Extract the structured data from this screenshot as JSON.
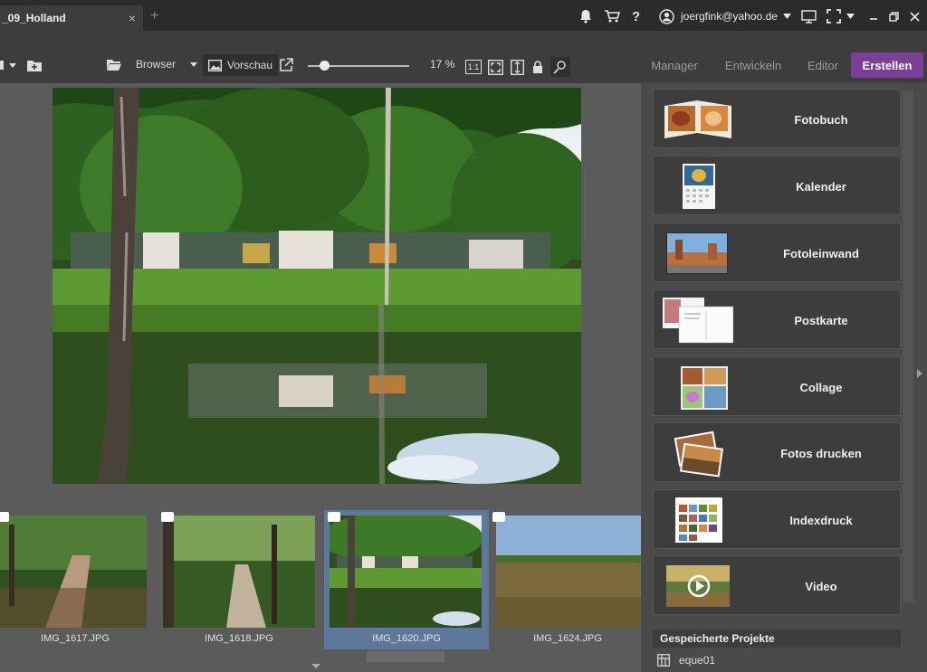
{
  "titlebar": {
    "tab_title": "_09_Holland",
    "tab_close": "×",
    "add_tab": "+",
    "user_email": "joergfink@yahoo.de"
  },
  "toolbar": {
    "browser_label": "Browser",
    "preview_label": "Vorschau",
    "zoom_level": "17 %",
    "zoom_fraction": 0.17,
    "ratio_label": "1:1"
  },
  "modes": [
    {
      "label": "Manager",
      "active": false
    },
    {
      "label": "Entwickeln",
      "active": false
    },
    {
      "label": "Editor",
      "active": false
    },
    {
      "label": "Erstellen",
      "active": true
    }
  ],
  "filmstrip": [
    {
      "name": "IMG_1617.JPG",
      "selected": false
    },
    {
      "name": "IMG_1618.JPG",
      "selected": false
    },
    {
      "name": "IMG_1620.JPG",
      "selected": true
    },
    {
      "name": "IMG_1624.JPG",
      "selected": false
    }
  ],
  "create_panel": {
    "items": [
      {
        "label": "Fotobuch",
        "icon": "photobook-icon"
      },
      {
        "label": "Kalender",
        "icon": "calendar-icon"
      },
      {
        "label": "Fotoleinwand",
        "icon": "canvas-print-icon"
      },
      {
        "label": "Postkarte",
        "icon": "postcard-icon"
      },
      {
        "label": "Collage",
        "icon": "collage-icon"
      },
      {
        "label": "Fotos drucken",
        "icon": "print-photos-icon"
      },
      {
        "label": "Indexdruck",
        "icon": "index-print-icon"
      },
      {
        "label": "Video",
        "icon": "video-icon"
      }
    ],
    "saved_projects_header": "Gespeicherte Projekte",
    "saved_projects": [
      {
        "name": "eque01"
      }
    ]
  },
  "colors": {
    "accent": "#7b3f98",
    "selection": "#5e7899",
    "titlebar": "#2b2b2b",
    "toolbar": "#3d3d3d"
  }
}
